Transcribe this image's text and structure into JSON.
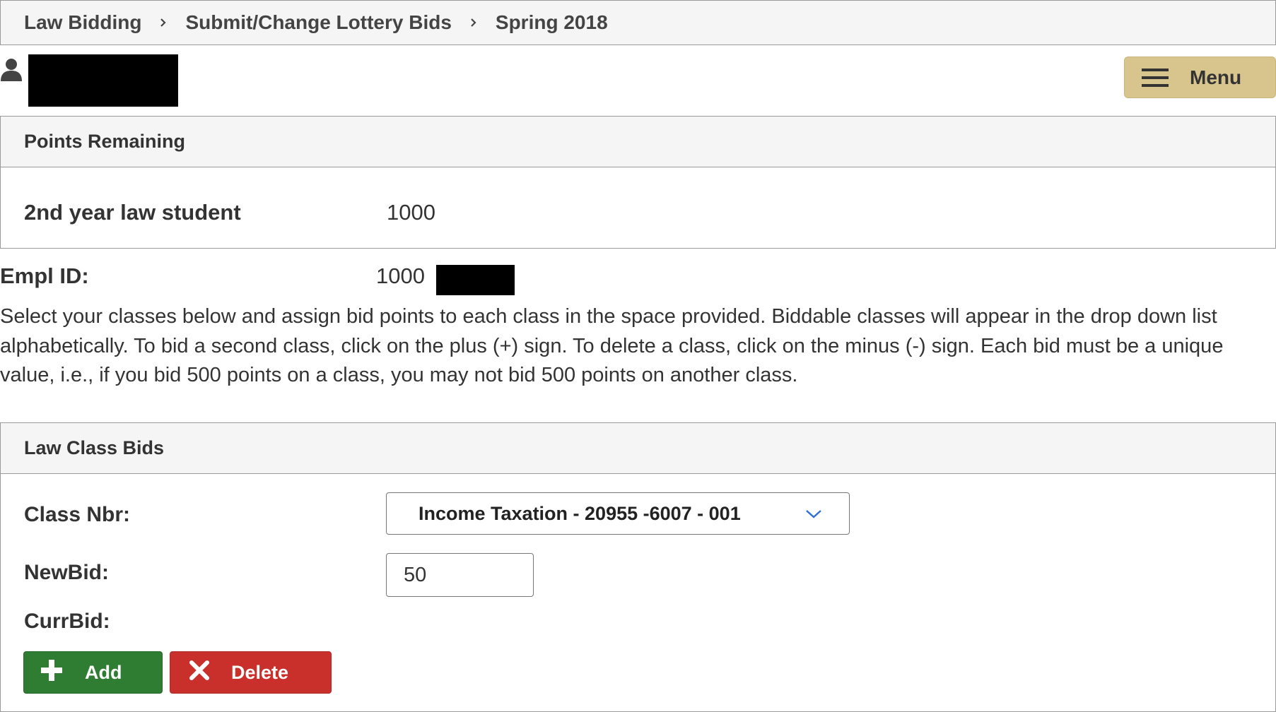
{
  "breadcrumb": {
    "items": [
      "Law Bidding",
      "Submit/Change Lottery Bids",
      "Spring 2018"
    ]
  },
  "header": {
    "menu_label": "Menu"
  },
  "points_panel": {
    "title": "Points Remaining",
    "student_type": "2nd year law student",
    "points": "1000"
  },
  "empl": {
    "label": "Empl ID:",
    "value_visible": "1000"
  },
  "instructions": "Select your classes below and assign bid points to each class in the space provided. Biddable classes will appear in the drop down list alphabetically. To bid a second class, click on the plus (+) sign. To delete a class, click on the minus (-) sign. Each bid must be a unique value, i.e., if you bid 500 points on a class, you may not bid 500 points on another class.",
  "bids_panel": {
    "title": "Law Class Bids",
    "class_nbr_label": "Class Nbr:",
    "class_selected": "Income Taxation - 20955 -6007 - 001",
    "newbid_label": "NewBid:",
    "newbid_value": "50",
    "currbid_label": "CurrBid:",
    "add_label": "Add",
    "delete_label": "Delete"
  },
  "colors": {
    "menu_bg": "#d8c58e",
    "add_bg": "#2e7d32",
    "delete_bg": "#c9302c",
    "select_chevron": "#2f6fd6"
  }
}
